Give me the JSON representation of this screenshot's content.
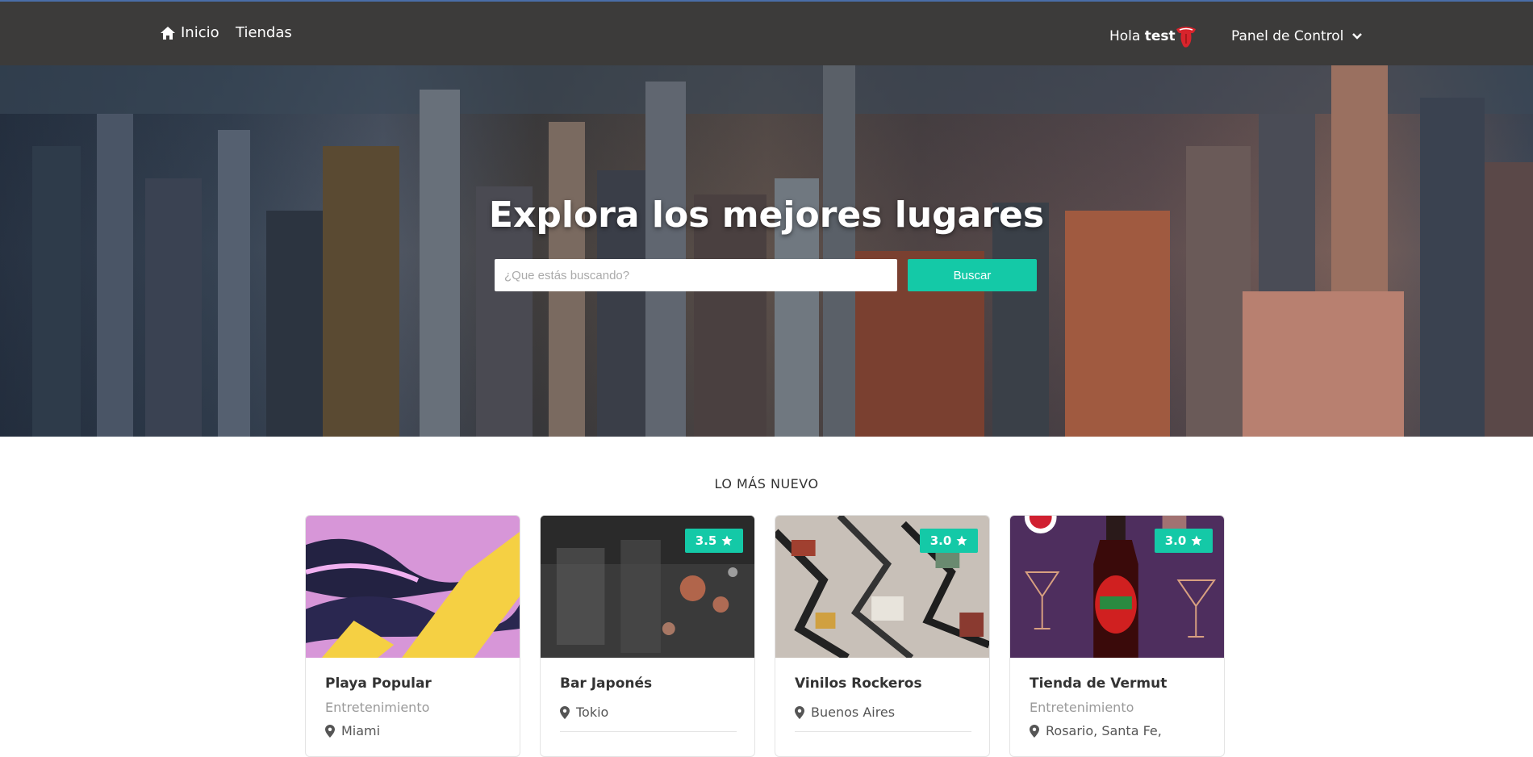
{
  "nav": {
    "home_label": "Inicio",
    "stores_label": "Tiendas",
    "greeting_prefix": "Hola",
    "username": "test",
    "panel_label": "Panel de Control"
  },
  "hero": {
    "title": "Explora los mejores lugares",
    "search_placeholder": "¿Que estás buscando?",
    "search_button": "Buscar"
  },
  "section": {
    "title": "LO MÁS NUEVO"
  },
  "cards": [
    {
      "title": "Playa Popular",
      "category": "Entretenimiento",
      "location": "Miami",
      "rating": ""
    },
    {
      "title": "Bar Japonés",
      "category": "",
      "location": "Tokio",
      "rating": "3.5"
    },
    {
      "title": "Vinilos Rockeros",
      "category": "",
      "location": "Buenos Aires",
      "rating": "3.0"
    },
    {
      "title": "Tienda de Vermut",
      "category": "Entretenimiento",
      "location": "Rosario, Santa Fe,",
      "rating": "3.0"
    }
  ],
  "colors": {
    "navbar": "#3c3b3a",
    "accent": "#14c9a7"
  }
}
